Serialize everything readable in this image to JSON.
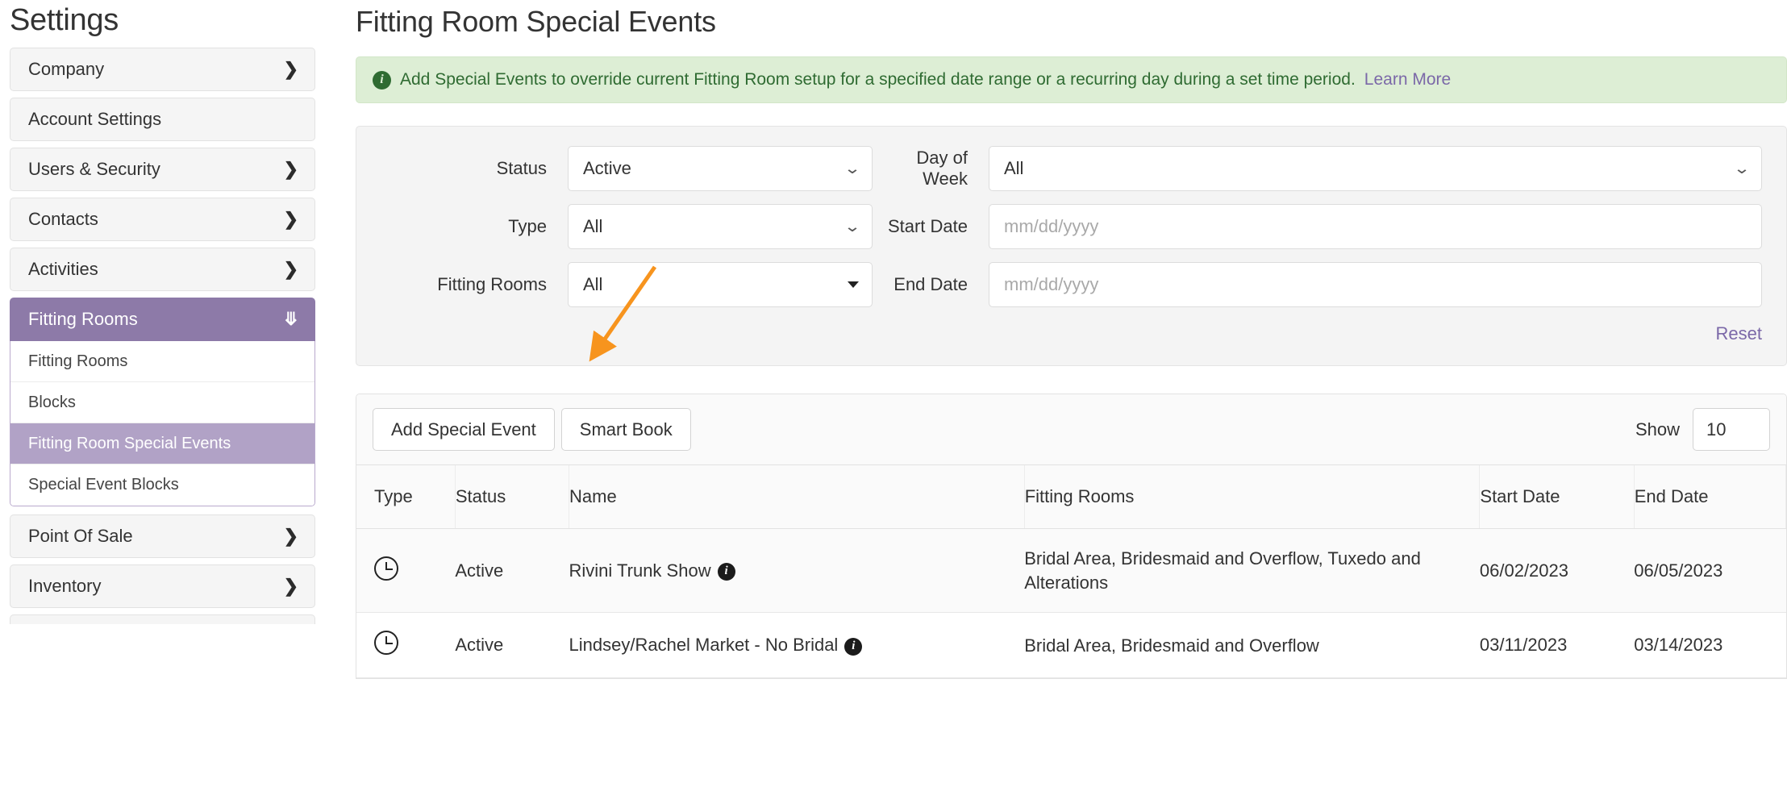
{
  "sidebar": {
    "title": "Settings",
    "items": [
      {
        "label": "Company",
        "icon": "chevron-right-icon"
      },
      {
        "label": "Account Settings",
        "icon": ""
      },
      {
        "label": "Users & Security",
        "icon": "chevron-right-icon"
      },
      {
        "label": "Contacts",
        "icon": "chevron-right-icon"
      },
      {
        "label": "Activities",
        "icon": "chevron-right-icon"
      }
    ],
    "active_group": {
      "label": "Fitting Rooms",
      "icon": "chevron-down-icon"
    },
    "sub_items": [
      {
        "label": "Fitting Rooms"
      },
      {
        "label": "Blocks"
      },
      {
        "label": "Fitting Room Special Events"
      },
      {
        "label": "Special Event Blocks"
      }
    ],
    "selected_sub": "Fitting Room Special Events",
    "items_after": [
      {
        "label": "Point Of Sale",
        "icon": "chevron-right-icon"
      },
      {
        "label": "Inventory",
        "icon": "chevron-right-icon"
      }
    ],
    "chevron_right": "❯",
    "chevron_down": "⌄",
    "accent_color": "#8d7aa8",
    "selected_color": "#b1a2c6"
  },
  "main": {
    "page_title": "Fitting Room Special Events",
    "alert": {
      "icon": "info-icon",
      "text": "Add Special Events to override current Fitting Room setup for a specified date range or a recurring day during a set time period.",
      "link_text": "Learn More",
      "bg_color": "#ddeed5",
      "text_color": "#2f6b32"
    },
    "filters": {
      "status": {
        "label": "Status",
        "value": "Active",
        "control": "select"
      },
      "type": {
        "label": "Type",
        "value": "All",
        "control": "select"
      },
      "fitting_rooms": {
        "label": "Fitting Rooms",
        "value": "All",
        "control": "multiselect"
      },
      "day_of_week": {
        "label": "Day of Week",
        "value": "All",
        "control": "select"
      },
      "start_date": {
        "label": "Start Date",
        "value": "",
        "placeholder": "mm/dd/yyyy",
        "control": "date"
      },
      "end_date": {
        "label": "End Date",
        "value": "",
        "placeholder": "mm/dd/yyyy",
        "control": "date"
      },
      "reset_label": "Reset"
    },
    "toolbar": {
      "add_label": "Add Special Event",
      "smart_book_label": "Smart Book",
      "show_label": "Show",
      "show_value": "10"
    },
    "table": {
      "columns": [
        "Type",
        "Status",
        "Name",
        "Fitting Rooms",
        "Start Date",
        "End Date"
      ],
      "rows": [
        {
          "type_icon": "clock-icon",
          "status": "Active",
          "name": "Rivini Trunk Show",
          "name_info_icon": "info-icon",
          "fitting_rooms": "Bridal Area, Bridesmaid and Overflow, Tuxedo and Alterations",
          "start_date": "06/02/2023",
          "end_date": "06/05/2023"
        },
        {
          "type_icon": "clock-icon",
          "status": "Active",
          "name": "Lindsey/Rachel Market - No Bridal",
          "name_info_icon": "info-icon",
          "fitting_rooms": "Bridal Area, Bridesmaid and Overflow",
          "start_date": "03/11/2023",
          "end_date": "03/14/2023"
        }
      ]
    },
    "annotation": {
      "type": "arrow",
      "color": "#f7941e",
      "points_to": "smart-book-button"
    }
  }
}
